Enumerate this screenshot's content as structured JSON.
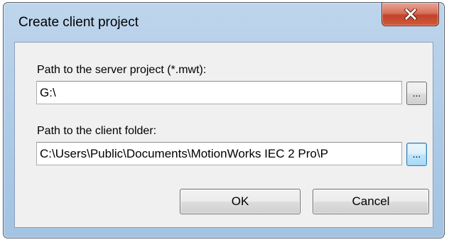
{
  "window": {
    "title": "Create client project",
    "close_icon": "close-icon"
  },
  "server_project": {
    "label": "Path to the server project (*.mwt):",
    "value": "G:\\",
    "browse_label": "..."
  },
  "client_folder": {
    "label": "Path to the client folder:",
    "value": "C:\\Users\\Public\\Documents\\MotionWorks IEC 2 Pro\\P",
    "browse_label": "..."
  },
  "buttons": {
    "ok_label": "OK",
    "cancel_label": "Cancel"
  },
  "colors": {
    "frame": "#aecbe7",
    "close_button": "#c2432a",
    "client_area": "#f0f0f0",
    "focused_button": "#bee6fd"
  }
}
